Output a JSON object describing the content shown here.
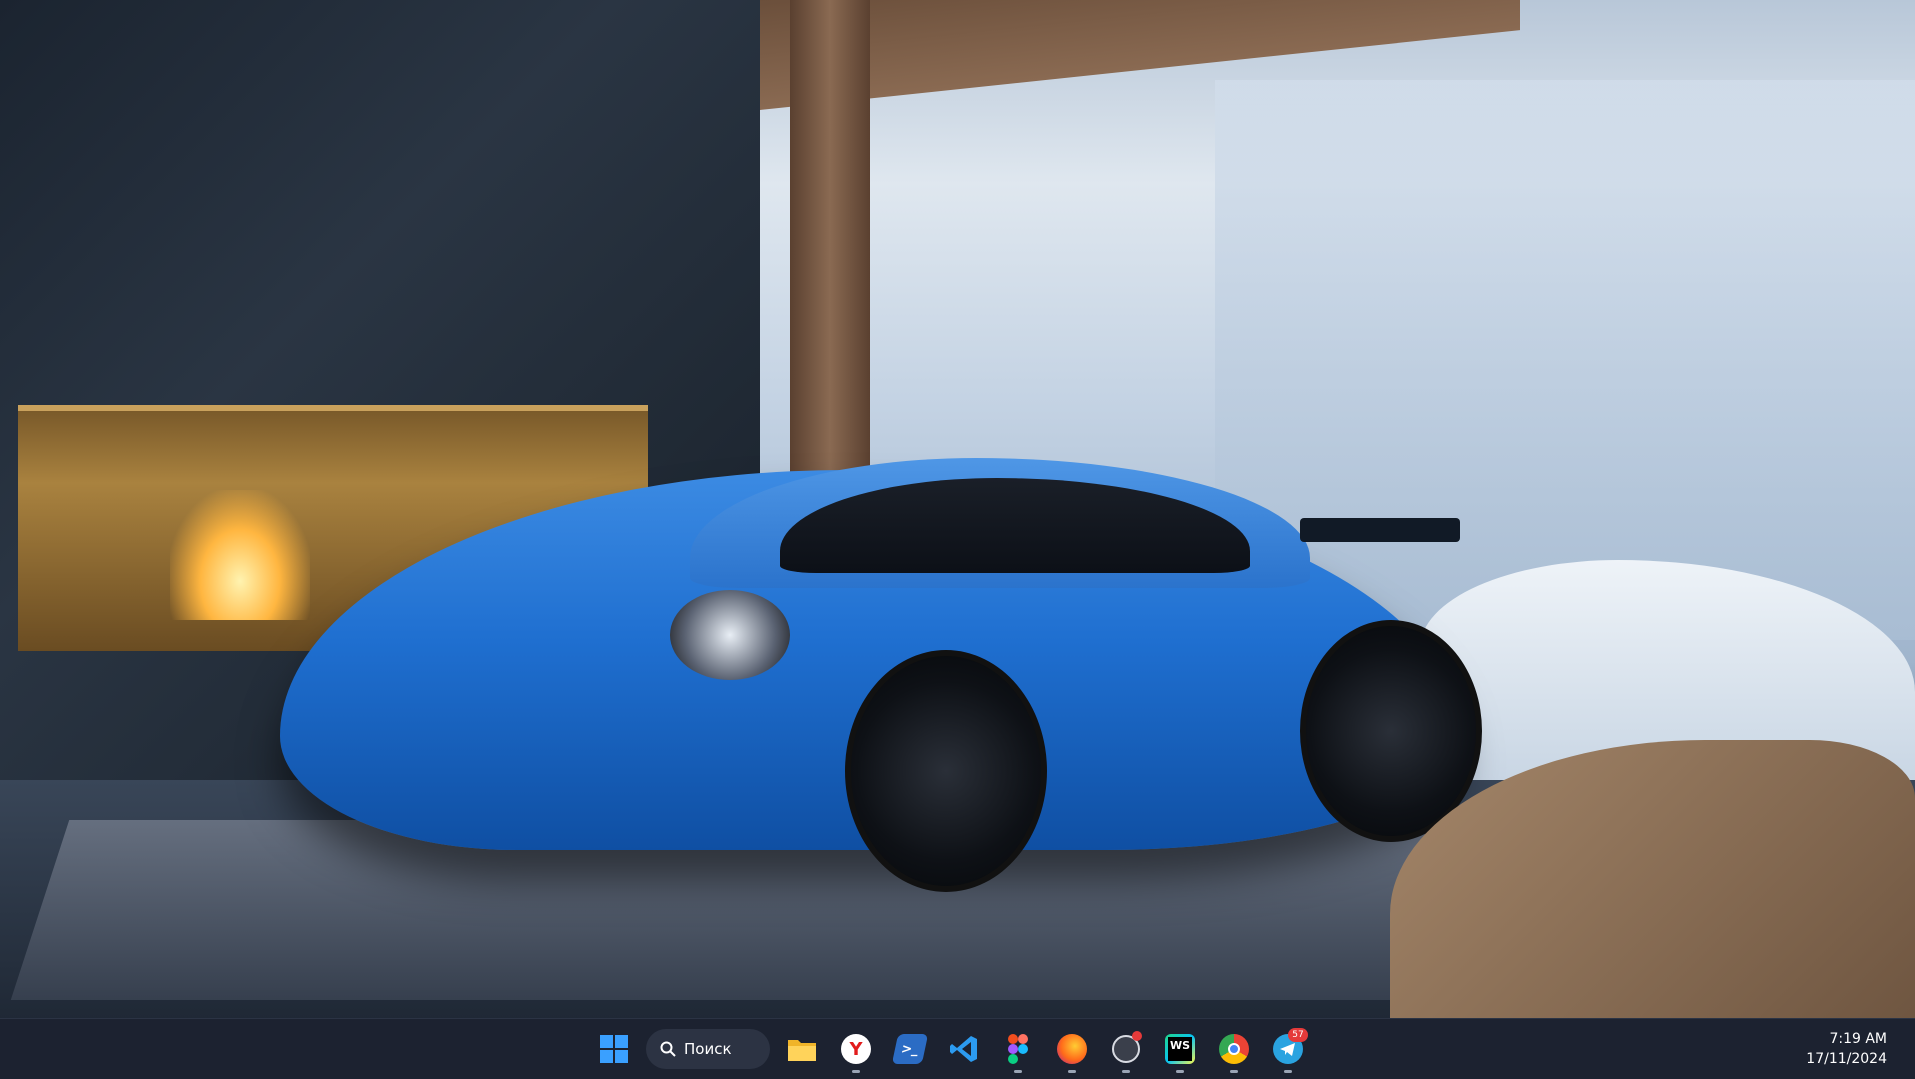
{
  "desktop": {
    "wallpaper": "blue sports car in chalet with fireplace and snowy forest",
    "colors": {
      "taskbar_bg": "#1c2230",
      "accent": "#3aa0ff"
    }
  },
  "taskbar": {
    "start_icon": "windows-logo-icon",
    "search_label": "Поиск",
    "apps": [
      {
        "name": "file-explorer-icon",
        "running": false
      },
      {
        "name": "yandex-browser-icon",
        "running": true
      },
      {
        "name": "powershell-icon",
        "running": false
      },
      {
        "name": "vscode-icon",
        "running": false
      },
      {
        "name": "figma-icon",
        "running": true
      },
      {
        "name": "firefox-icon",
        "running": true
      },
      {
        "name": "obs-icon",
        "running": true
      },
      {
        "name": "webstorm-icon",
        "running": true,
        "label": "WS"
      },
      {
        "name": "chrome-icon",
        "running": true
      },
      {
        "name": "telegram-icon",
        "running": true,
        "badge": "57"
      }
    ],
    "clock": {
      "time": "7:19 AM",
      "date": "17/11/2024"
    }
  }
}
